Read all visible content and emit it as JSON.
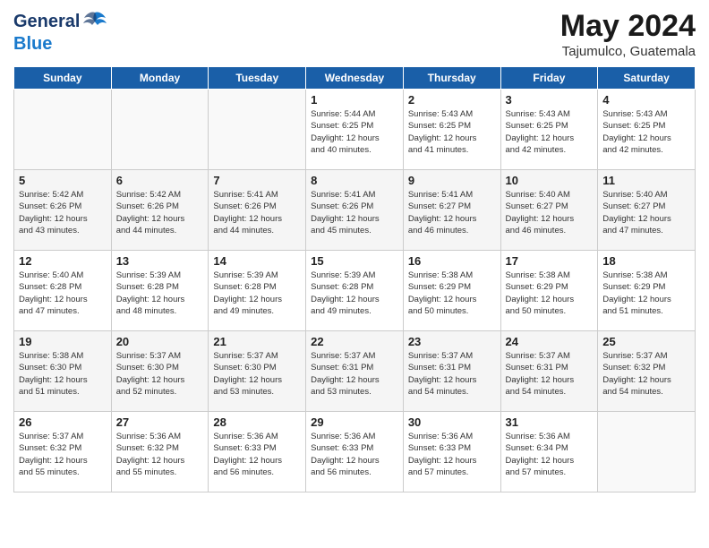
{
  "header": {
    "logo_general": "General",
    "logo_blue": "Blue",
    "month_title": "May 2024",
    "subtitle": "Tajumulco, Guatemala"
  },
  "days_of_week": [
    "Sunday",
    "Monday",
    "Tuesday",
    "Wednesday",
    "Thursday",
    "Friday",
    "Saturday"
  ],
  "weeks": [
    [
      {
        "day": "",
        "info": ""
      },
      {
        "day": "",
        "info": ""
      },
      {
        "day": "",
        "info": ""
      },
      {
        "day": "1",
        "info": "Sunrise: 5:44 AM\nSunset: 6:25 PM\nDaylight: 12 hours\nand 40 minutes."
      },
      {
        "day": "2",
        "info": "Sunrise: 5:43 AM\nSunset: 6:25 PM\nDaylight: 12 hours\nand 41 minutes."
      },
      {
        "day": "3",
        "info": "Sunrise: 5:43 AM\nSunset: 6:25 PM\nDaylight: 12 hours\nand 42 minutes."
      },
      {
        "day": "4",
        "info": "Sunrise: 5:43 AM\nSunset: 6:25 PM\nDaylight: 12 hours\nand 42 minutes."
      }
    ],
    [
      {
        "day": "5",
        "info": "Sunrise: 5:42 AM\nSunset: 6:26 PM\nDaylight: 12 hours\nand 43 minutes."
      },
      {
        "day": "6",
        "info": "Sunrise: 5:42 AM\nSunset: 6:26 PM\nDaylight: 12 hours\nand 44 minutes."
      },
      {
        "day": "7",
        "info": "Sunrise: 5:41 AM\nSunset: 6:26 PM\nDaylight: 12 hours\nand 44 minutes."
      },
      {
        "day": "8",
        "info": "Sunrise: 5:41 AM\nSunset: 6:26 PM\nDaylight: 12 hours\nand 45 minutes."
      },
      {
        "day": "9",
        "info": "Sunrise: 5:41 AM\nSunset: 6:27 PM\nDaylight: 12 hours\nand 46 minutes."
      },
      {
        "day": "10",
        "info": "Sunrise: 5:40 AM\nSunset: 6:27 PM\nDaylight: 12 hours\nand 46 minutes."
      },
      {
        "day": "11",
        "info": "Sunrise: 5:40 AM\nSunset: 6:27 PM\nDaylight: 12 hours\nand 47 minutes."
      }
    ],
    [
      {
        "day": "12",
        "info": "Sunrise: 5:40 AM\nSunset: 6:28 PM\nDaylight: 12 hours\nand 47 minutes."
      },
      {
        "day": "13",
        "info": "Sunrise: 5:39 AM\nSunset: 6:28 PM\nDaylight: 12 hours\nand 48 minutes."
      },
      {
        "day": "14",
        "info": "Sunrise: 5:39 AM\nSunset: 6:28 PM\nDaylight: 12 hours\nand 49 minutes."
      },
      {
        "day": "15",
        "info": "Sunrise: 5:39 AM\nSunset: 6:28 PM\nDaylight: 12 hours\nand 49 minutes."
      },
      {
        "day": "16",
        "info": "Sunrise: 5:38 AM\nSunset: 6:29 PM\nDaylight: 12 hours\nand 50 minutes."
      },
      {
        "day": "17",
        "info": "Sunrise: 5:38 AM\nSunset: 6:29 PM\nDaylight: 12 hours\nand 50 minutes."
      },
      {
        "day": "18",
        "info": "Sunrise: 5:38 AM\nSunset: 6:29 PM\nDaylight: 12 hours\nand 51 minutes."
      }
    ],
    [
      {
        "day": "19",
        "info": "Sunrise: 5:38 AM\nSunset: 6:30 PM\nDaylight: 12 hours\nand 51 minutes."
      },
      {
        "day": "20",
        "info": "Sunrise: 5:37 AM\nSunset: 6:30 PM\nDaylight: 12 hours\nand 52 minutes."
      },
      {
        "day": "21",
        "info": "Sunrise: 5:37 AM\nSunset: 6:30 PM\nDaylight: 12 hours\nand 53 minutes."
      },
      {
        "day": "22",
        "info": "Sunrise: 5:37 AM\nSunset: 6:31 PM\nDaylight: 12 hours\nand 53 minutes."
      },
      {
        "day": "23",
        "info": "Sunrise: 5:37 AM\nSunset: 6:31 PM\nDaylight: 12 hours\nand 54 minutes."
      },
      {
        "day": "24",
        "info": "Sunrise: 5:37 AM\nSunset: 6:31 PM\nDaylight: 12 hours\nand 54 minutes."
      },
      {
        "day": "25",
        "info": "Sunrise: 5:37 AM\nSunset: 6:32 PM\nDaylight: 12 hours\nand 54 minutes."
      }
    ],
    [
      {
        "day": "26",
        "info": "Sunrise: 5:37 AM\nSunset: 6:32 PM\nDaylight: 12 hours\nand 55 minutes."
      },
      {
        "day": "27",
        "info": "Sunrise: 5:36 AM\nSunset: 6:32 PM\nDaylight: 12 hours\nand 55 minutes."
      },
      {
        "day": "28",
        "info": "Sunrise: 5:36 AM\nSunset: 6:33 PM\nDaylight: 12 hours\nand 56 minutes."
      },
      {
        "day": "29",
        "info": "Sunrise: 5:36 AM\nSunset: 6:33 PM\nDaylight: 12 hours\nand 56 minutes."
      },
      {
        "day": "30",
        "info": "Sunrise: 5:36 AM\nSunset: 6:33 PM\nDaylight: 12 hours\nand 57 minutes."
      },
      {
        "day": "31",
        "info": "Sunrise: 5:36 AM\nSunset: 6:34 PM\nDaylight: 12 hours\nand 57 minutes."
      },
      {
        "day": "",
        "info": ""
      }
    ]
  ]
}
